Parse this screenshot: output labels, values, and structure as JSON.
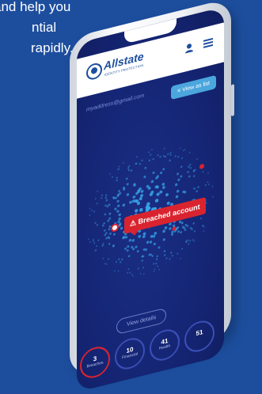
{
  "promo": {
    "line1": "and help you",
    "line2": "ntial",
    "line3": "rapidly."
  },
  "app": {
    "brand": "Allstate",
    "brand_sub": "IDENTITY PROTECTION",
    "email": "myaddress@gmail.com",
    "view_as_list_label": "View as list",
    "breach_tooltip": "Breached account",
    "view_details_label": "View details"
  },
  "stats": [
    {
      "value": "3",
      "label": "Breaches"
    },
    {
      "value": "10",
      "label": "Financial"
    },
    {
      "value": "41",
      "label": "Health"
    },
    {
      "value": "51",
      "label": ""
    }
  ],
  "colors": {
    "background": "#1d4e9e",
    "screen": "#152574",
    "dots": "#3aa6ea",
    "alert": "#d9242f",
    "button": "#4ba6de"
  },
  "icons": {
    "logo": "allstate-hands-icon",
    "profile": "profile-icon",
    "menu": "hamburger-menu-icon",
    "list": "list-icon",
    "breach": "alert-pin-icon"
  }
}
